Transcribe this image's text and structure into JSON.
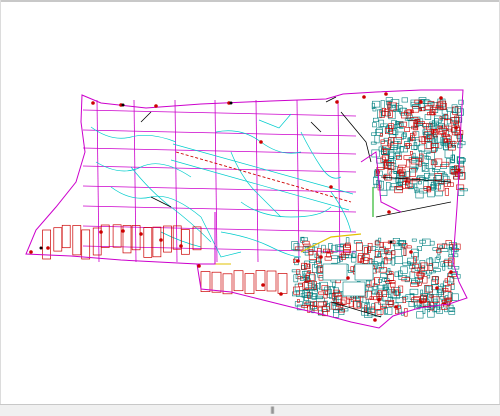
{
  "colors": {
    "boundary": "#cc00cc",
    "grid": "#cc00cc",
    "roads": "#00cccc",
    "parcels": "#cc0000",
    "buildings": "#008080",
    "points": "#cc0000",
    "dark_lines": "#000000",
    "green_lines": "#00aa00",
    "yellow_lines": "#e0c000",
    "background": "#ffffff"
  },
  "icons": {
    "scroll_grip": "grip-lines-icon"
  },
  "statusbar": {
    "grip_glyph": "|||"
  }
}
